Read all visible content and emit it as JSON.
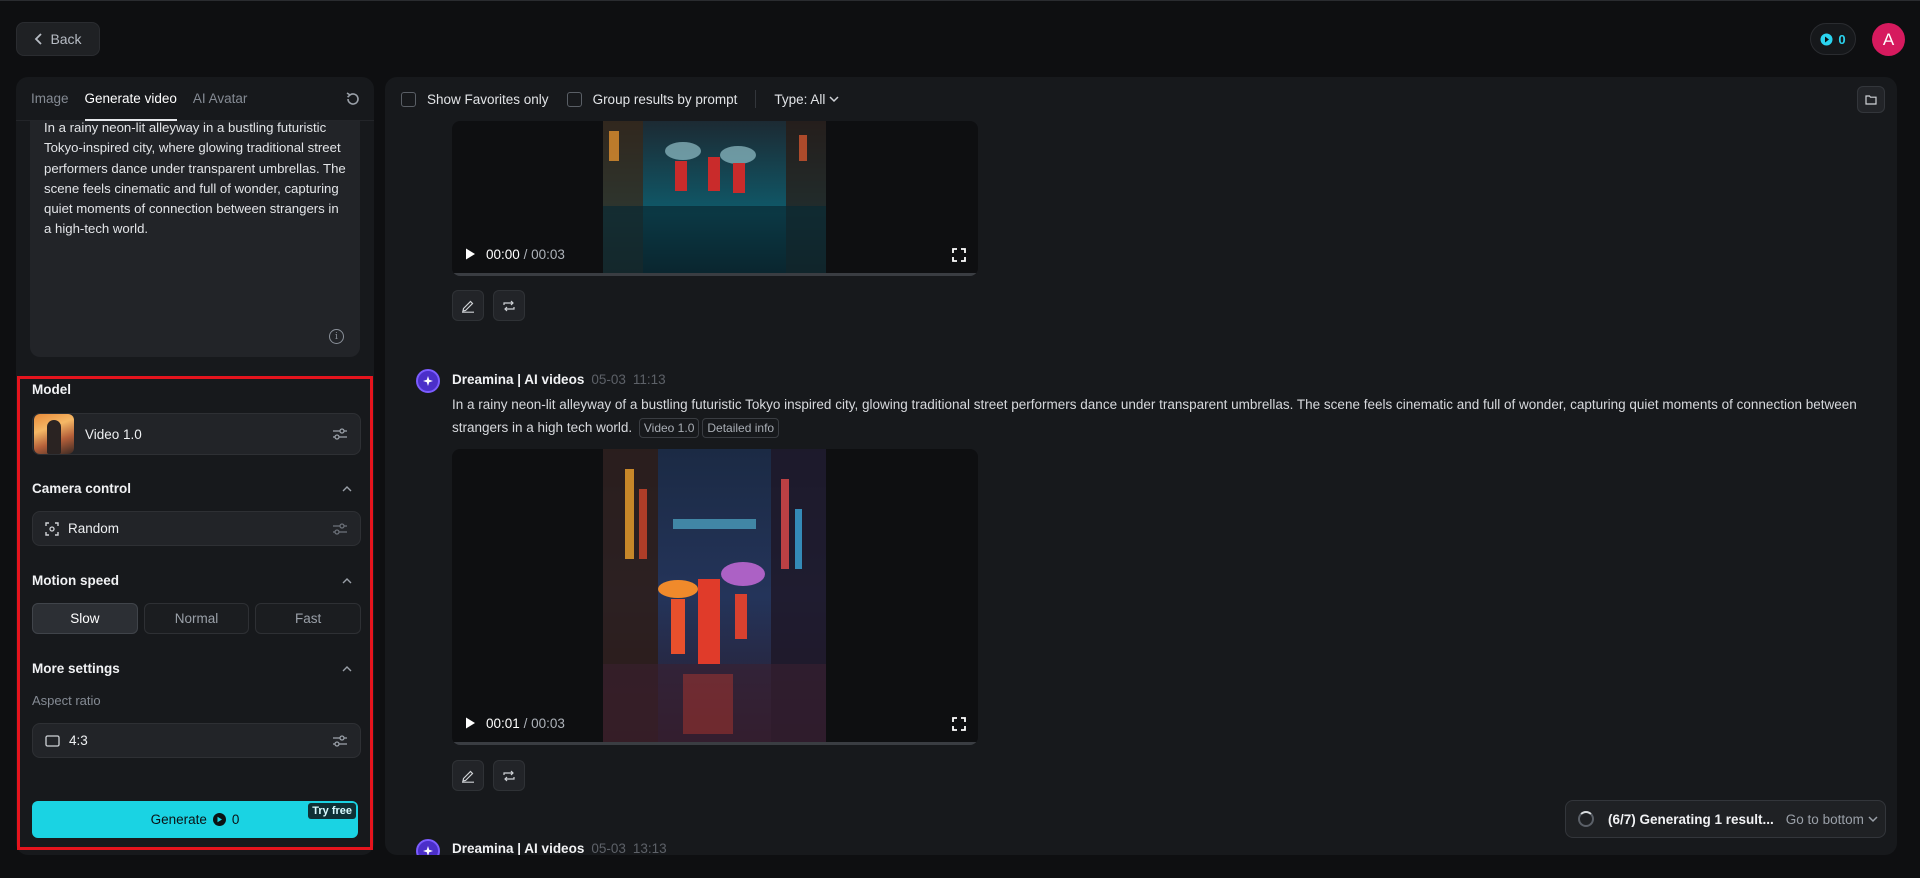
{
  "header": {
    "back_label": "Back",
    "credits": "0",
    "avatar_letter": "A"
  },
  "left": {
    "tabs": [
      {
        "label": "Image"
      },
      {
        "label": "Generate video"
      },
      {
        "label": "AI Avatar"
      }
    ],
    "prompt": "In a rainy neon-lit alleyway in a bustling futuristic Tokyo-inspired city, where glowing traditional street performers dance under transparent umbrellas. The scene feels cinematic and full of wonder, capturing quiet moments of connection between strangers in a high-tech world.",
    "model": {
      "title": "Model",
      "value": "Video 1.0"
    },
    "camera": {
      "title": "Camera control",
      "value": "Random"
    },
    "motion": {
      "title": "Motion speed",
      "options": [
        "Slow",
        "Normal",
        "Fast"
      ],
      "selected": "Slow"
    },
    "more": {
      "title": "More settings",
      "aspect_label": "Aspect ratio",
      "aspect_value": "4:3"
    },
    "generate": {
      "label": "Generate",
      "cost": "0",
      "badge": "Try free"
    }
  },
  "main": {
    "toolbar": {
      "favorites": "Show Favorites only",
      "group": "Group results by prompt",
      "type": "Type: All"
    },
    "videos": [
      {
        "current": "00:00",
        "total": "/ 00:03"
      },
      {
        "current": "00:01",
        "total": "/ 00:03"
      }
    ],
    "entries": [
      {
        "name": "Dreamina | AI videos",
        "date": "05-03",
        "time": "11:13",
        "prompt": "In a rainy neon-lit alleyway of a bustling futuristic Tokyo inspired city, glowing traditional street performers dance under transparent umbrellas. The scene feels cinematic and full of wonder, capturing quiet moments of connection between strangers in a high tech world.",
        "tags": [
          "Video 1.0",
          "Detailed info"
        ]
      },
      {
        "name": "Dreamina | AI videos",
        "date": "05-03",
        "time": "13:13"
      }
    ],
    "status": {
      "text": "(6/7) Generating 1 result...",
      "goto": "Go to bottom"
    }
  },
  "colors": {
    "accent": "#1ad3e3",
    "highlight_frame": "#e5141d",
    "avatar": "#d61a5e"
  }
}
